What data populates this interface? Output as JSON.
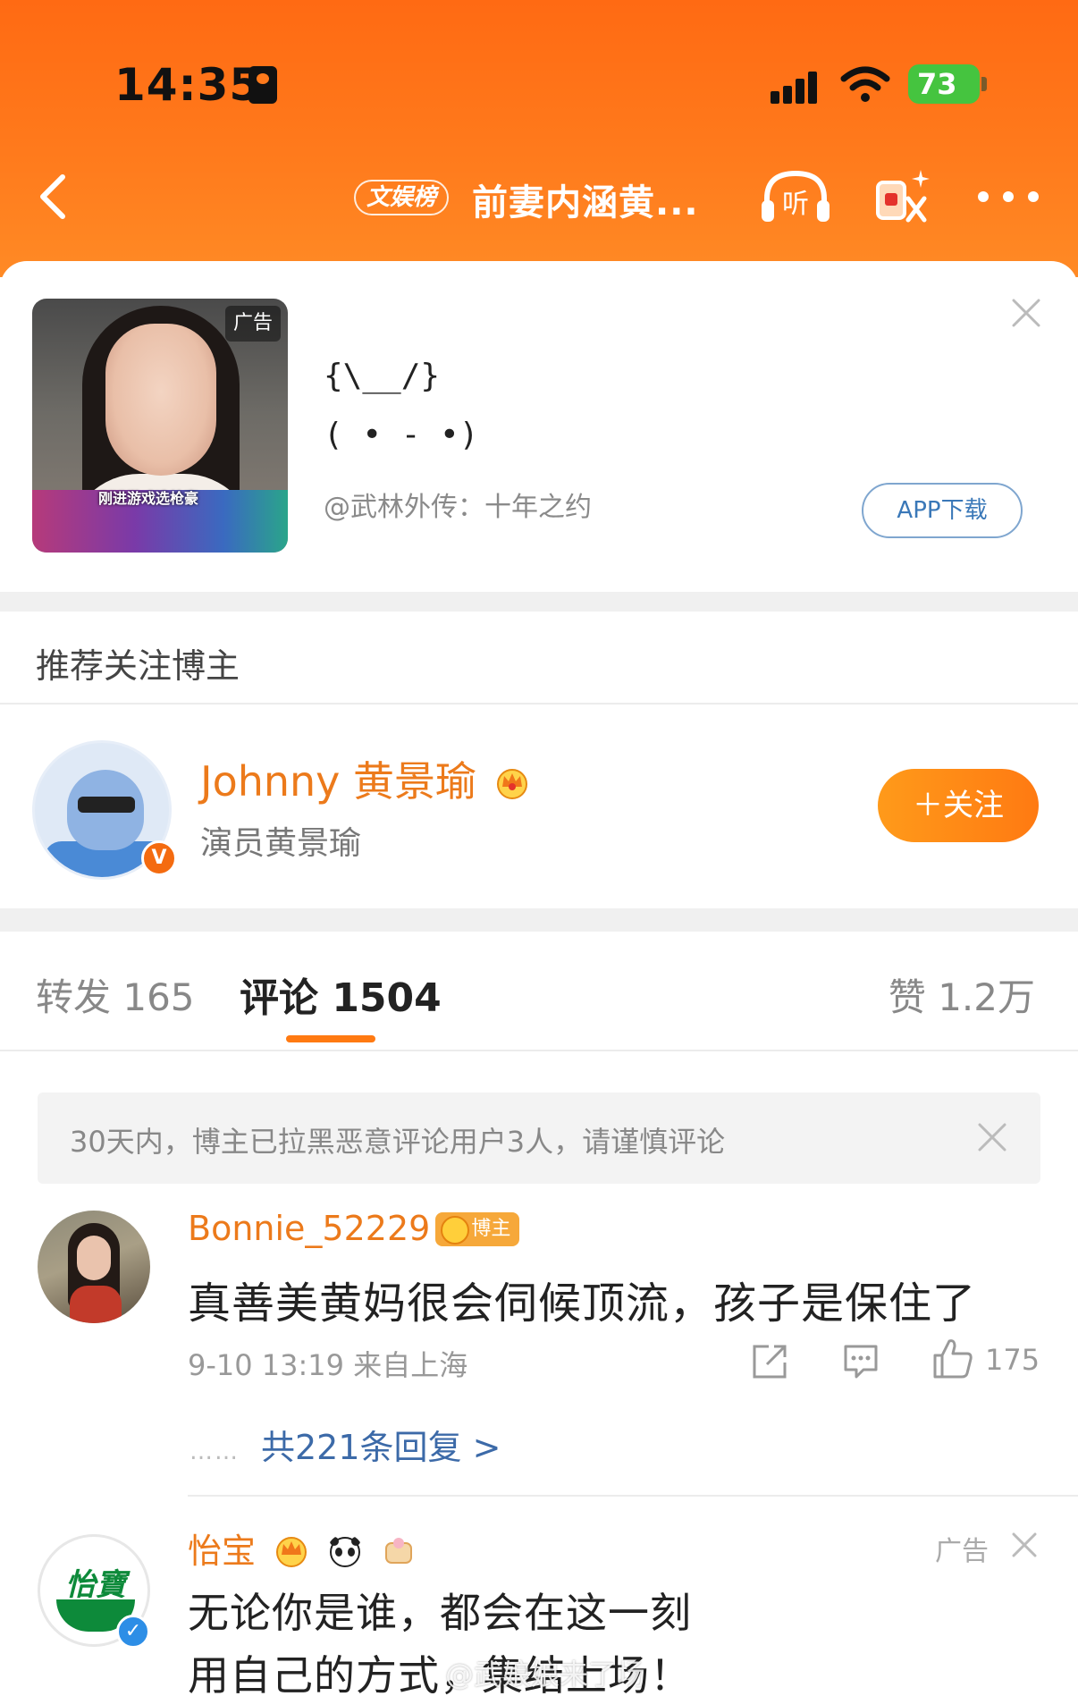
{
  "status_bar": {
    "time": "14:35",
    "battery": "73"
  },
  "nav": {
    "rank_badge": "文娱榜",
    "title": "前妻内涵黄..."
  },
  "ad": {
    "tag": "广告",
    "thumb_caption": "刚进游戏选枪豪",
    "line1": "{\\__/}",
    "line2": "( • - •)",
    "source": "@武林外传：十年之约",
    "download_label": "APP下载"
  },
  "recommend": {
    "title": "推荐关注博主",
    "user_name": "Johnny 黄景瑜",
    "user_desc": "演员黄景瑜",
    "follow_label": "＋关注",
    "verified_mark": "V"
  },
  "tabs": {
    "repost": "转发 165",
    "comment": "评论 1504",
    "likes": "赞 1.2万"
  },
  "notice": {
    "text": "30天内，博主已拉黑恶意评论用户3人，请谨慎评论"
  },
  "comments": [
    {
      "user": "Bonnie_52229",
      "badge": "博主",
      "text": "真善美黄妈很会伺候顶流，孩子是保住了",
      "meta": "9-10 13:19  来自上海",
      "likes": "175",
      "replies_dots": "……",
      "replies": "共221条回复 >"
    },
    {
      "user": "怡宝",
      "avatar_brand": "怡寶",
      "ad_tag": "广告",
      "text_line1": "无论你是谁，都会在这一刻",
      "text_line2": "用自己的方式，集结上场！",
      "verified_mark": "✓"
    }
  ],
  "watermark": "@武娘娘来了场",
  "colors": {
    "header_orange": "#ff7a1c",
    "username_orange": "#ec7a1b",
    "link_blue": "#3c6aa8",
    "battery_green": "#45c43f"
  },
  "icons": [
    "back-icon",
    "listen-icon",
    "share-icon",
    "more-icon",
    "close-icon",
    "crown-icon",
    "share-out-icon",
    "reply-icon",
    "thumbs-up-icon"
  ]
}
